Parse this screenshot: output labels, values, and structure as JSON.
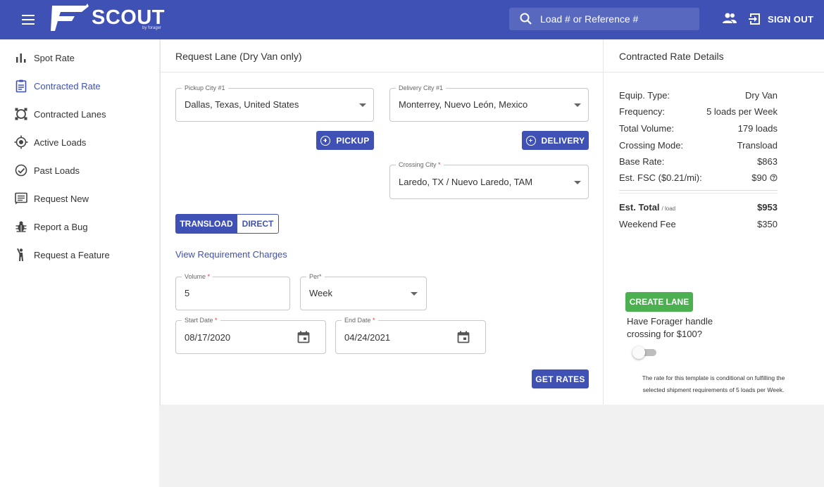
{
  "header": {
    "logo_text": "SCOUT",
    "logo_sub": "by forager",
    "search_placeholder": "Load # or Reference #",
    "signout_label": "SIGN OUT",
    "brand_color": "#3f51b5"
  },
  "sidebar": {
    "items": [
      {
        "label": "Spot Rate",
        "icon": "bar-chart-icon"
      },
      {
        "label": "Contracted Rate",
        "icon": "clipboard-icon",
        "active": true
      },
      {
        "label": "Contracted Lanes",
        "icon": "lanes-icon"
      },
      {
        "label": "Active Loads",
        "icon": "target-icon"
      },
      {
        "label": "Past Loads",
        "icon": "check-circle-icon"
      },
      {
        "label": "Request New",
        "icon": "list-icon"
      },
      {
        "label": "Report a Bug",
        "icon": "bug-icon"
      },
      {
        "label": "Request a Feature",
        "icon": "person-raise-hand-icon"
      }
    ]
  },
  "request": {
    "title": "Request Lane (Dry Van only)",
    "pickup": {
      "label": "Pickup City #1",
      "value": "Dallas, Texas, United States"
    },
    "delivery": {
      "label": "Delivery City #1",
      "value": "Monterrey, Nuevo León, Mexico"
    },
    "pickup_btn": "PICKUP",
    "delivery_btn": "DELIVERY",
    "crossing": {
      "label": "Crossing City",
      "value": "Laredo, TX / Nuevo Laredo, TAM"
    },
    "mode_options": [
      "TRANSLOAD",
      "DIRECT"
    ],
    "mode_selected": "TRANSLOAD",
    "view_charges": "View Requirement Charges",
    "volume": {
      "label": "Volume",
      "value": "5"
    },
    "per": {
      "label": "Per*",
      "value": "Week"
    },
    "start_date": {
      "label": "Start Date",
      "value": "08/17/2020"
    },
    "end_date": {
      "label": "End Date",
      "value": "04/24/2021"
    },
    "get_rates": "GET RATES"
  },
  "rate_details": {
    "title": "Contracted Rate Details",
    "rows": [
      {
        "label": "Equip. Type:",
        "value": "Dry Van"
      },
      {
        "label": "Frequency:",
        "value": "5 loads per Week"
      },
      {
        "label": "Total Volume:",
        "value": "179 loads"
      },
      {
        "label": "Crossing Mode:",
        "value": "Transload"
      },
      {
        "label": "Base Rate:",
        "value": "$863"
      },
      {
        "label": "Est. FSC ($0.21/mi):",
        "value": "$90"
      }
    ],
    "total_label": "Est. Total",
    "total_unit": "/ load",
    "total_value": "$953",
    "weekend_label": "Weekend Fee",
    "weekend_value": "$350",
    "create_btn": "CREATE LANE",
    "forager_question": "Have Forager handle crossing for $100?",
    "forager_toggle_on": false,
    "disclaimer_1": "The rate for this template is conditional on fulfilling the",
    "disclaimer_2": "selected shipment requirements of 5 loads per Week."
  }
}
